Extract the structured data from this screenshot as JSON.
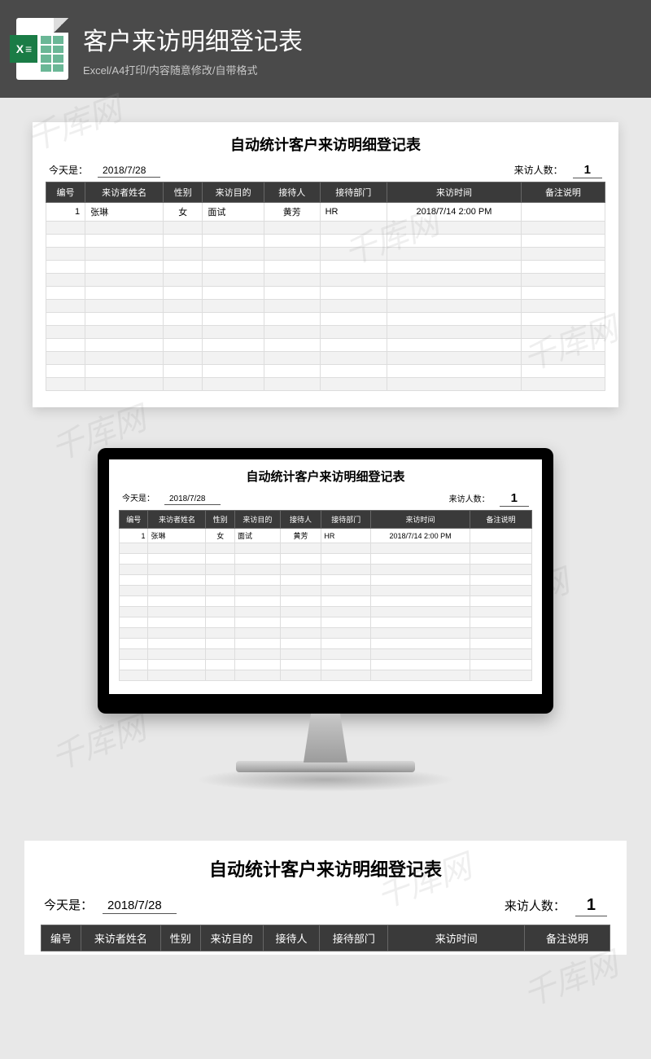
{
  "header": {
    "title": "客户来访明细登记表",
    "subtitle": "Excel/A4打印/内容随意修改/自带格式"
  },
  "sheet": {
    "title": "自动统计客户来访明细登记表",
    "today_label": "今天是：",
    "today_value": "2018/7/28",
    "count_label": "来访人数：",
    "count_value": "1"
  },
  "columns": {
    "id": "编号",
    "name": "来访者姓名",
    "gender": "性别",
    "purpose": "来访目的",
    "receiver": "接待人",
    "dept": "接待部门",
    "time": "来访时间",
    "remark": "备注说明"
  },
  "row": {
    "id": "1",
    "name": "张琳",
    "gender": "女",
    "purpose": "面试",
    "receiver": "黄芳",
    "dept": "HR",
    "time": "2018/7/14 2:00 PM",
    "remark": ""
  },
  "watermark": "千库网"
}
